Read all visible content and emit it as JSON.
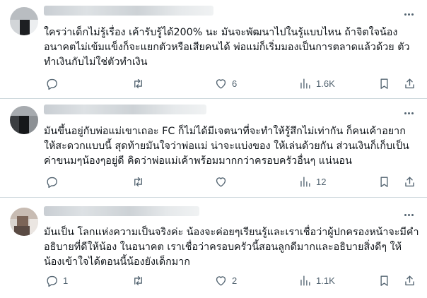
{
  "posts": [
    {
      "lines": [
        "ใครว่าเด็กไม่รู้เรื่อง เค้ารับรู้ได้200% นะ มันจะพัฒนาไปในรู้แบบไหน ถ้าจิตใจน้อง",
        "อนาคตไม่เข้มแข็งก็จะแยกตัวหรือเสียคนได้  พ่อแม่ก็เริ่มมองเป็นการตลาดแล้วด้วย ตัว",
        "ทำเงินกับไม่ใช่ตัวทำเงิน"
      ],
      "replies": "",
      "reposts": "",
      "likes": "6",
      "views": "1.6K"
    },
    {
      "lines": [
        "มันขึ้นอยู่กับพ่อแม่เขาเถอะ FC ก็ไม่ได้มีเจตนาที่จะทำให้รู้สึกไม่เท่ากัน ก็คนเค้าอยาก",
        "ให้สะดวกแบบนี้ สุดท้ายมันใจว่าพ่อแม่ น่าจะแบ่งของ ให้เล่นด้วยกัน ส่วนเงินก็เก็บเป็น",
        "ค่าขนมๆน้องๆอยู่ดี คิดว่าพ่อแม่เค้าพร้อมมากกว่าครอบครัวอื่นๆ แน่นอน"
      ],
      "replies": "",
      "reposts": "",
      "likes": "",
      "views": "12"
    },
    {
      "lines": [
        "มันเป็น โลกแห่งความเป็นจริงค่ะ น้องจะค่อยๆเรียนรู้และเราเชื่อว่าผู้ปกครองหน้าจะมีคำ",
        "อธิบายที่ดีให้น้อง ในอนาคต เราเชื่อว่าครอบครัวนี้สอนลูกดีมากและอธิบายสิ่งดีๆ ให้",
        "น้องเข้าใจได้ตอนนี้น้องยังเด็กมาก"
      ],
      "replies": "1",
      "reposts": "",
      "likes": "2",
      "views": "1.1K"
    }
  ],
  "icons": {
    "reply": "reply-icon",
    "repost": "repost-icon",
    "like": "like-icon",
    "views": "views-icon",
    "bookmark": "bookmark-icon",
    "share": "share-icon",
    "more": "more-icon"
  },
  "colors": {
    "text": "#0f1419",
    "secondary": "#536471",
    "divider": "#cfd9de"
  }
}
